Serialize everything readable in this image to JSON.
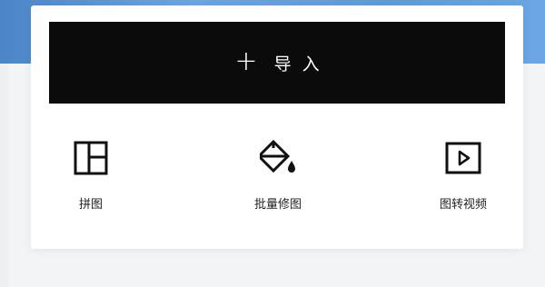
{
  "import_button": {
    "plus": "+",
    "label": "导入"
  },
  "tools": {
    "collage": {
      "label": "拼图",
      "icon": "collage-layout-icon"
    },
    "batch_edit": {
      "label": "批量修图",
      "icon": "paint-bucket-icon"
    },
    "video": {
      "label": "图转视频",
      "icon": "play-video-icon"
    }
  },
  "colors": {
    "banner": "#5f9bd9",
    "import_bg": "#0b0b0b",
    "card_bg": "#ffffff",
    "text": "#222222"
  }
}
